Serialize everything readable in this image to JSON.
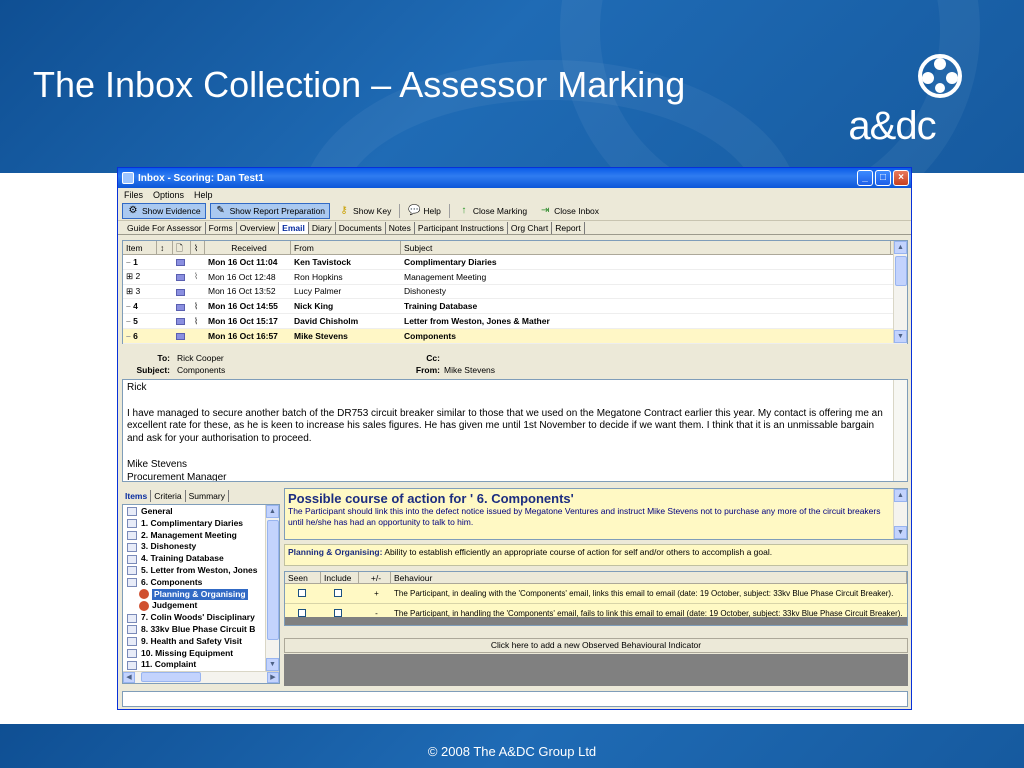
{
  "slide": {
    "title": "The Inbox Collection – Assessor Marking",
    "logo_text": "a&dc",
    "footer": "© 2008 The A&DC Group Ltd"
  },
  "window": {
    "title": "Inbox - Scoring: Dan Test1",
    "menu": [
      "Files",
      "Options",
      "Help"
    ],
    "toolbar": {
      "show_evidence": "Show Evidence",
      "show_report_prep": "Show Report Preparation",
      "show_key": "Show Key",
      "help": "Help",
      "close_marking": "Close Marking",
      "close_inbox": "Close Inbox"
    },
    "tabs": [
      "Guide For Assessor",
      "Forms",
      "Overview",
      "Email",
      "Diary",
      "Documents",
      "Notes",
      "Participant Instructions",
      "Org Chart",
      "Report"
    ],
    "active_tab": "Email"
  },
  "email_list": {
    "headers": {
      "item": "Item",
      "received": "Received",
      "from": "From",
      "subject": "Subject"
    },
    "rows": [
      {
        "item": "1",
        "received": "Mon 16 Oct 11:04",
        "from": "Ken Tavistock",
        "subject": "Complimentary Diaries",
        "bold": true,
        "expand": false,
        "attach": false
      },
      {
        "item": "2",
        "received": "Mon 16 Oct 12:48",
        "from": "Ron  Hopkins",
        "subject": "Management Meeting",
        "bold": false,
        "expand": true,
        "attach": true
      },
      {
        "item": "3",
        "received": "Mon 16 Oct 13:52",
        "from": "Lucy  Palmer",
        "subject": "Dishonesty",
        "bold": false,
        "expand": true,
        "attach": false
      },
      {
        "item": "4",
        "received": "Mon 16 Oct 14:55",
        "from": "Nick  King",
        "subject": "Training Database",
        "bold": true,
        "expand": false,
        "attach": true
      },
      {
        "item": "5",
        "received": "Mon 16 Oct 15:17",
        "from": "David  Chisholm",
        "subject": "Letter from Weston, Jones & Mather",
        "bold": true,
        "expand": false,
        "attach": true
      },
      {
        "item": "6",
        "received": "Mon 16 Oct 16:57",
        "from": "Mike  Stevens",
        "subject": "Components",
        "bold": true,
        "expand": false,
        "attach": false,
        "selected": true
      }
    ]
  },
  "email_header": {
    "to_label": "To:",
    "to": "Rick Cooper",
    "subject_label": "Subject:",
    "subject": "Components",
    "cc_label": "Cc:",
    "cc": "",
    "from_label": "From:",
    "from": "Mike  Stevens"
  },
  "email_body": [
    "Rick",
    "",
    "I have managed to secure another batch of the DR753 circuit breaker similar to those that we used on the Megatone Contract earlier this year.  My contact is offering me an excellent rate for these, as he is keen to increase his sales figures.  He has given me until 1st November to decide if we want them.  I think that it is an unmissable bargain and ask for your authorisation to proceed.",
    "",
    "Mike Stevens",
    "Procurement Manager"
  ],
  "left_pane": {
    "tabs": [
      "Items",
      "Criteria",
      "Summary"
    ],
    "active_tab": "Items",
    "tree": [
      {
        "label": "General",
        "indent": 0,
        "kind": "doc"
      },
      {
        "label": "1. Complimentary Diaries",
        "indent": 0,
        "kind": "doc"
      },
      {
        "label": "2. Management Meeting",
        "indent": 0,
        "kind": "doc"
      },
      {
        "label": "3. Dishonesty",
        "indent": 0,
        "kind": "doc"
      },
      {
        "label": "4. Training Database",
        "indent": 0,
        "kind": "doc"
      },
      {
        "label": "5. Letter from Weston, Jones",
        "indent": 0,
        "kind": "doc"
      },
      {
        "label": "6. Components",
        "indent": 0,
        "kind": "doc"
      },
      {
        "label": "Planning & Organising",
        "indent": 1,
        "kind": "person",
        "selected": true
      },
      {
        "label": "Judgement",
        "indent": 1,
        "kind": "person"
      },
      {
        "label": "7. Colin Woods' Disciplinary",
        "indent": 0,
        "kind": "doc"
      },
      {
        "label": "8. 33kv Blue Phase Circuit B",
        "indent": 0,
        "kind": "doc"
      },
      {
        "label": "9. Health and Safety Visit",
        "indent": 0,
        "kind": "doc"
      },
      {
        "label": "10. Missing Equipment",
        "indent": 0,
        "kind": "doc"
      },
      {
        "label": "11. Complaint",
        "indent": 0,
        "kind": "doc"
      }
    ]
  },
  "course": {
    "title": "Possible course of action for ' 6. Components'",
    "text": "The Participant should link this into the defect notice issued by Megatone Ventures and instruct Mike Stevens not to purchase any more of the circuit breakers until he/she has had an opportunity to talk to him."
  },
  "competency": {
    "label": "Planning & Organising:",
    "text": "Ability to establish efficiently an appropriate course of action for self and/or others to accomplish a goal."
  },
  "behaviours": {
    "headers": {
      "seen": "Seen",
      "include": "Include",
      "pm": "+/-",
      "behaviour": "Behaviour"
    },
    "rows": [
      {
        "pm": "+",
        "text": "The Participant, in dealing with the 'Components' email, links this email to email (date: 19 October, subject: 33kv Blue Phase Circuit Breaker)."
      },
      {
        "pm": "-",
        "text": "The Participant, in handling the 'Components' email, fails to link this email to email (date: 19 October, subject: 33kv Blue Phase Circuit Breaker)."
      }
    ]
  },
  "add_button": "Click here to add a new Observed Behavioural Indicator",
  "colors": {
    "banner": "#1f6bb5",
    "selected_row": "#fff7c6",
    "highlight": "#316ac5"
  }
}
